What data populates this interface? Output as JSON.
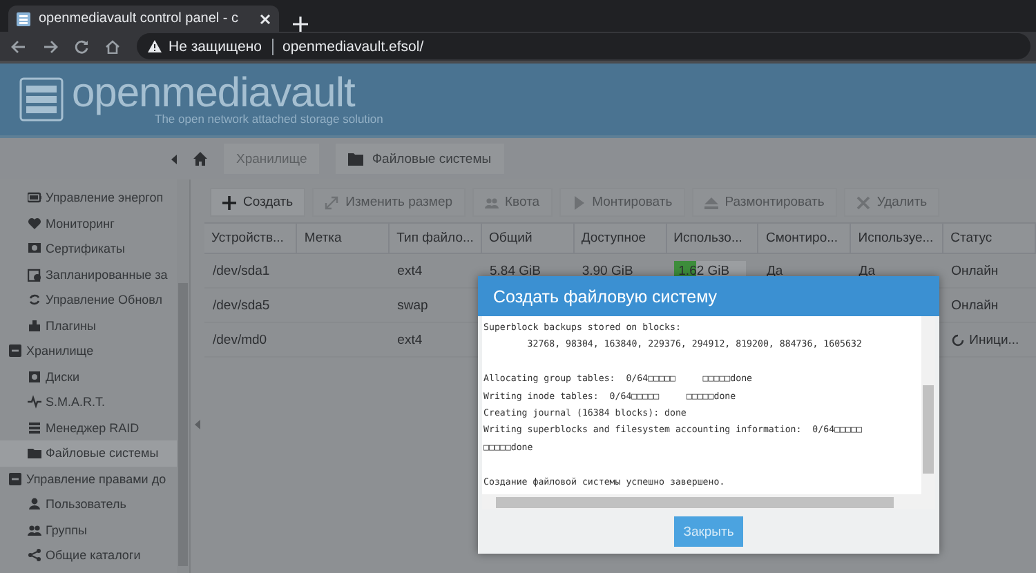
{
  "browser": {
    "tab_title": "openmediavault control panel - c",
    "address_warning": "Не защищено",
    "url": "openmediavault.efsol/"
  },
  "header": {
    "logo": "openmediavault",
    "tagline": "The open network attached storage solution"
  },
  "breadcrumb": {
    "items": [
      {
        "label": "Хранилище",
        "kind": "link"
      },
      {
        "label": "Файловые системы",
        "kind": "current"
      }
    ]
  },
  "sidebar": {
    "loose_items": [
      {
        "label": "Управление энергоп"
      },
      {
        "label": "Мониторинг"
      },
      {
        "label": "Сертификаты"
      },
      {
        "label": "Запланированные за"
      },
      {
        "label": "Управление Обновл"
      },
      {
        "label": "Плагины"
      }
    ],
    "groups": [
      {
        "label": "Хранилище",
        "expanded": true,
        "children": [
          {
            "label": "Диски",
            "selected": false
          },
          {
            "label": "S.M.A.R.T.",
            "selected": false
          },
          {
            "label": "Менеджер RAID",
            "selected": false
          },
          {
            "label": "Файловые системы",
            "selected": true
          }
        ]
      },
      {
        "label": "Управление правами до",
        "expanded": true,
        "children": [
          {
            "label": "Пользователь",
            "selected": false
          },
          {
            "label": "Группы",
            "selected": false
          },
          {
            "label": "Общие каталоги",
            "selected": false
          }
        ]
      }
    ]
  },
  "toolbar": [
    {
      "label": "Создать",
      "disabled": false
    },
    {
      "label": "Изменить размер",
      "disabled": true
    },
    {
      "label": "Квота",
      "disabled": true
    },
    {
      "label": "Монтировать",
      "disabled": true
    },
    {
      "label": "Размонтировать",
      "disabled": true
    },
    {
      "label": "Удалить",
      "disabled": true
    }
  ],
  "table": {
    "columns": [
      "Устройств...",
      "Метка",
      "Тип файло...",
      "Общий",
      "Доступное",
      "Использо...",
      "Смонтиро...",
      "Используе...",
      "Статус"
    ],
    "rows": [
      {
        "device": "/dev/sda1",
        "type": "ext4",
        "total": "5.84 GiB",
        "available": "3.90 GiB",
        "used": {
          "text": "1.62 GiB",
          "level": 0.3
        },
        "mounted": "Да",
        "referenced": "Да",
        "status": {
          "text": "Онлайн",
          "busy": false
        }
      },
      {
        "device": "/dev/sda5",
        "type": "swap",
        "status": {
          "text": "Онлайн",
          "busy": false
        }
      },
      {
        "device": "/dev/md0",
        "type": "ext4",
        "status": {
          "text": "Иници...",
          "busy": true
        }
      }
    ]
  },
  "dialog": {
    "title": "Создать файловую систему",
    "log": "Superblock backups stored on blocks:\n\t32768, 98304, 163840, 229376, 294912, 819200, 884736, 1605632\n\nAllocating group tables:  0/64□□□□□     □□□□□done\nWriting inode tables:  0/64□□□□□     □□□□□done\nCreating journal (16384 blocks): done\nWriting superblocks and filesystem accounting information:  0/64□□□□□\n□□□□□done\n\nСоздание файловой системы успешно завершено.",
    "button": "Закрыть"
  }
}
